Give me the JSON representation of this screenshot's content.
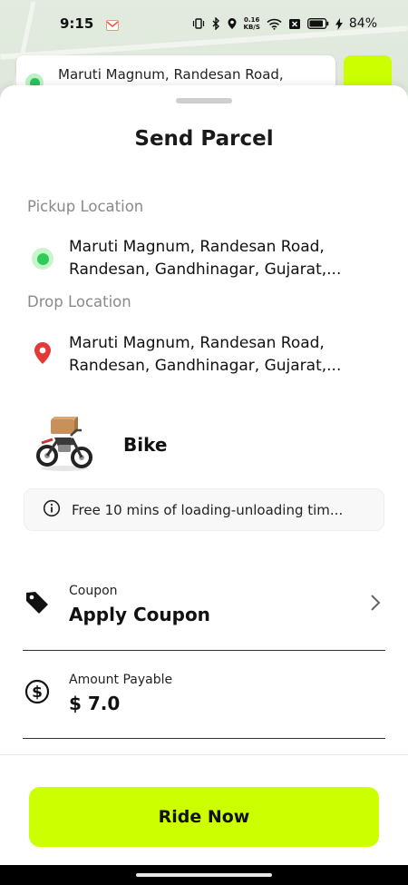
{
  "status_bar": {
    "time": "9:15",
    "net_speed_value": "0.16",
    "net_speed_unit": "KB/S",
    "battery": "84%"
  },
  "top_chip": {
    "text": "Maruti Magnum, Randesan Road,"
  },
  "sheet": {
    "title": "Send Parcel",
    "pickup": {
      "label": "Pickup Location",
      "line1": "Maruti Magnum, Randesan Road,",
      "line2": "Randesan, Gandhinagar, Gujarat,..."
    },
    "drop": {
      "label": "Drop Location",
      "line1": "Maruti Magnum, Randesan Road,",
      "line2": "Randesan, Gandhinagar, Gujarat,..."
    },
    "vehicle": {
      "name": "Bike"
    },
    "info": {
      "text": "Free 10 mins of loading-unloading tim..."
    },
    "coupon": {
      "label": "Coupon",
      "value": "Apply Coupon"
    },
    "amount": {
      "label": "Amount Payable",
      "value": "$ 7.0"
    },
    "ride_button": "Ride Now"
  },
  "colors": {
    "accent": "#ccff00",
    "pickup_green": "#2fcc59",
    "drop_red": "#e53935"
  }
}
